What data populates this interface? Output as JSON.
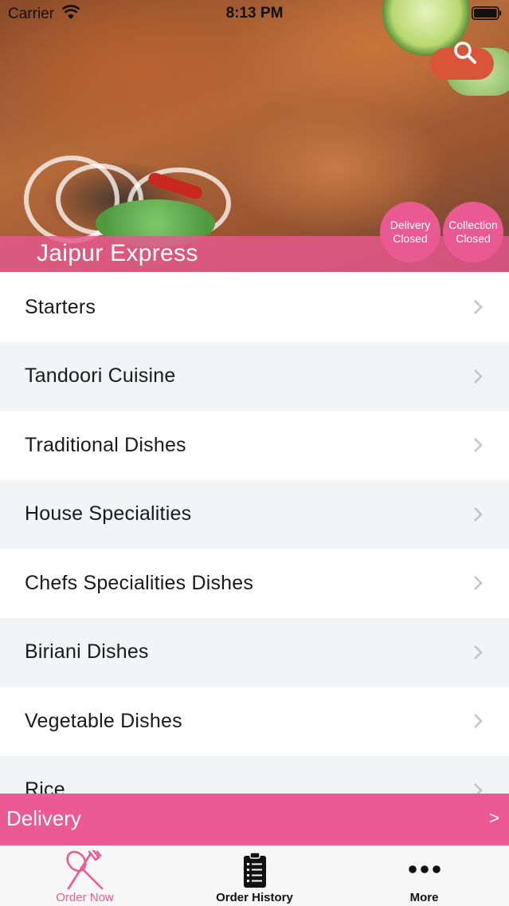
{
  "status_bar": {
    "carrier": "Carrier",
    "time": "8:13 PM"
  },
  "hero": {
    "restaurant_name": "Jaipur Express",
    "delivery_status": {
      "line1": "Delivery",
      "line2": "Closed"
    },
    "collection_status": {
      "line1": "Collection",
      "line2": "Closed"
    }
  },
  "menu": {
    "items": [
      {
        "label": "Starters"
      },
      {
        "label": "Tandoori Cuisine"
      },
      {
        "label": "Traditional Dishes"
      },
      {
        "label": "House Specialities"
      },
      {
        "label": "Chefs Specialities Dishes"
      },
      {
        "label": "Biriani Dishes"
      },
      {
        "label": "Vegetable Dishes"
      },
      {
        "label": "Rice"
      }
    ]
  },
  "delivery_bar": {
    "label": "Delivery",
    "arrow": ">"
  },
  "tabs": [
    {
      "label": "Order Now",
      "icon": "fork-knife-icon",
      "active": true
    },
    {
      "label": "Order History",
      "icon": "clipboard-icon",
      "active": false
    },
    {
      "label": "More",
      "icon": "more-icon",
      "active": false
    }
  ],
  "colors": {
    "accent": "#ec5a93",
    "row_alt": "#f3f4f6",
    "chevron": "#c4c4c8"
  }
}
